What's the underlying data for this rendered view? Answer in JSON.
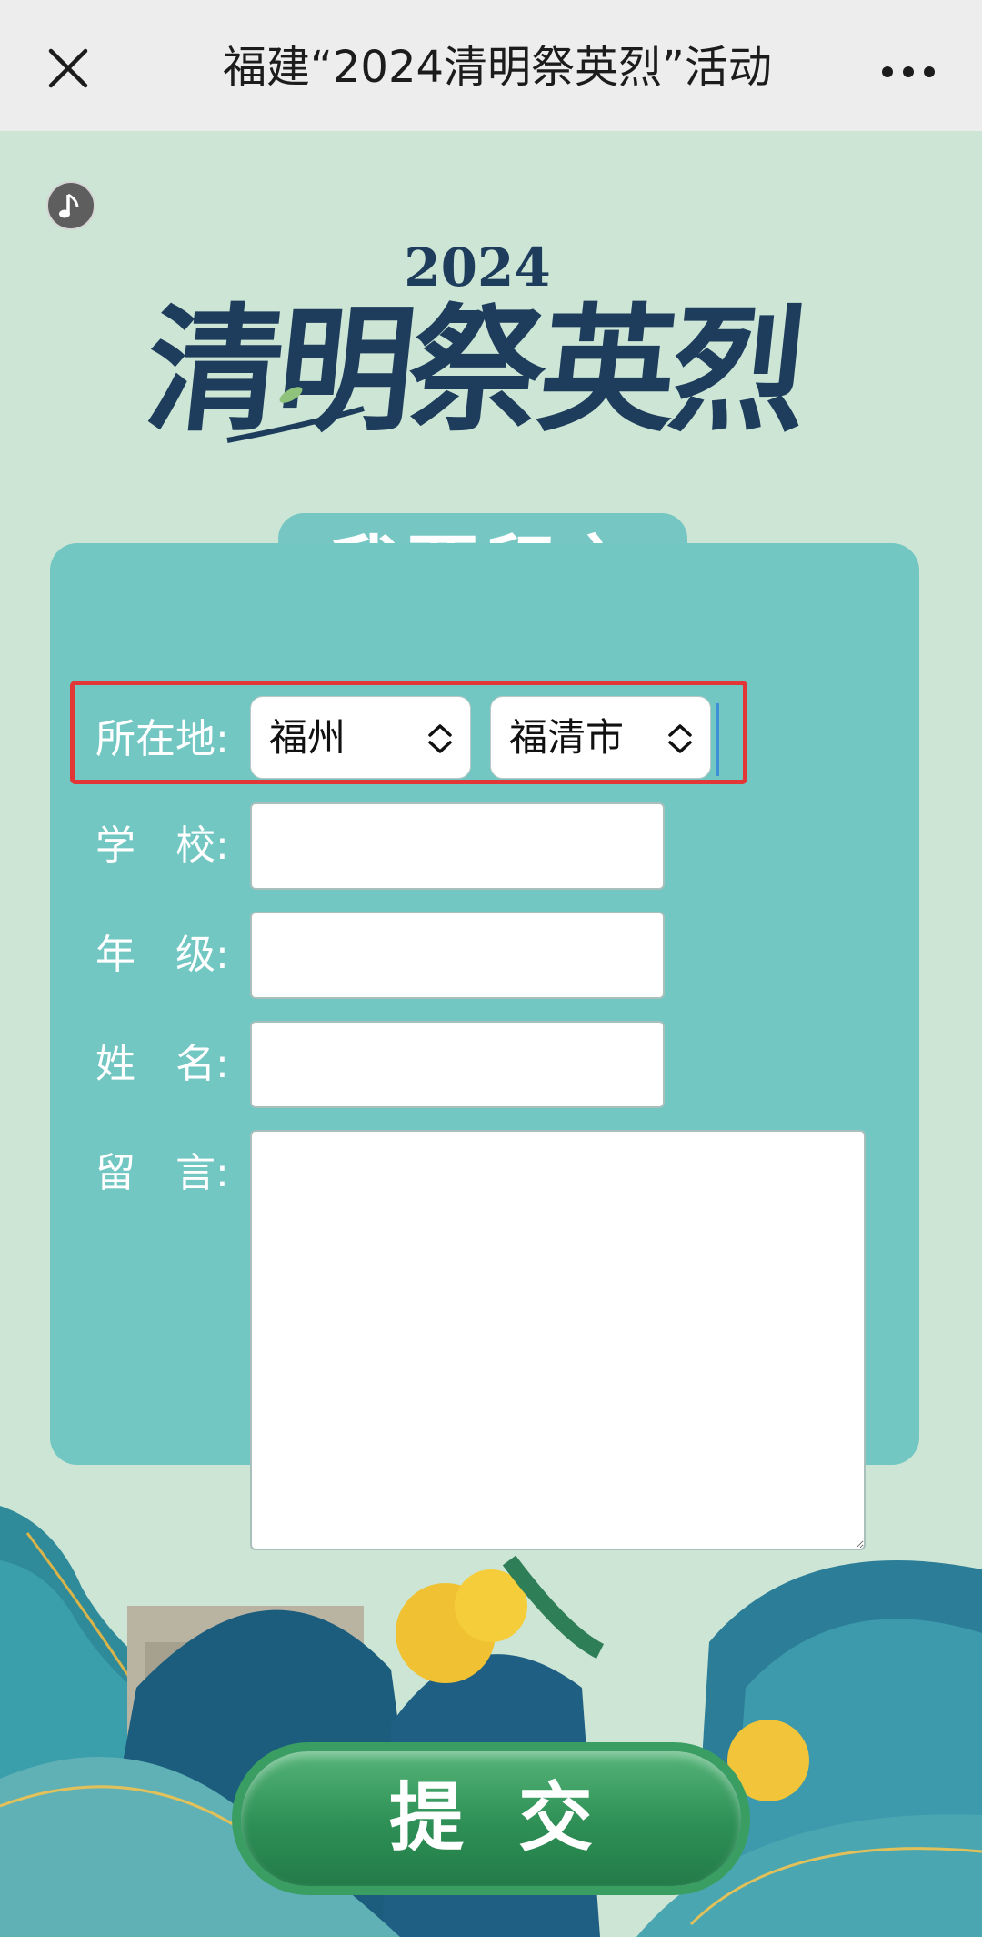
{
  "topbar": {
    "title": "福建“2024清明祭英烈”活动",
    "close_icon": "close-icon",
    "more_icon": "more-dots-icon"
  },
  "music_icon": "music-note-icon",
  "logo": {
    "year": "2024",
    "title": "清明祭英烈"
  },
  "leave_message_label": "我要留言",
  "form": {
    "location_label": "所在地:",
    "city_value": "福州",
    "district_value": "福清市",
    "school_label": "学　校:",
    "grade_label": "年　级:",
    "name_label": "姓　名:",
    "message_label": "留　言:",
    "school_value": "",
    "grade_value": "",
    "name_value": "",
    "message_value": ""
  },
  "submit_label": "提交",
  "colors": {
    "background": "#cce5d4",
    "card": "#73c7c3",
    "highlight": "#e33737",
    "logo_text": "#1e3d5c",
    "submit": "#2d8f55"
  }
}
